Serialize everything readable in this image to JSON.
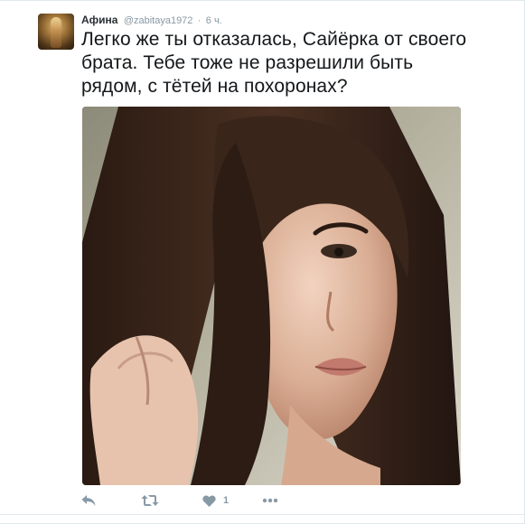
{
  "tweet": {
    "author_name": "Афина",
    "author_handle": "@zabitaya1972",
    "separator": "·",
    "time": "6 ч.",
    "text": "Легко же ты отказалась, Сайёрка от своего брата. Тебе тоже не разрешили быть рядом, с тётей на похоронах?",
    "like_count": "1"
  },
  "icons": {
    "reply": "reply-icon",
    "retweet": "retweet-icon",
    "like": "heart-icon",
    "more": "more-dots-icon"
  },
  "colors": {
    "action_gray": "#8899a6",
    "text": "#14171a",
    "name": "#292f33"
  }
}
